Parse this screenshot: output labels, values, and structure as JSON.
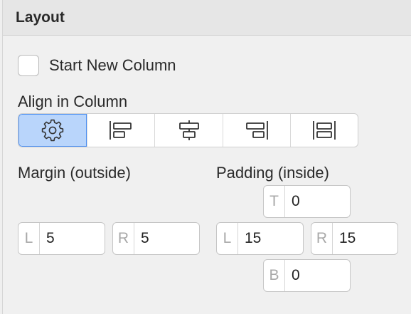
{
  "panel": {
    "title": "Layout"
  },
  "start_new_column": {
    "label": "Start New Column",
    "checked": false
  },
  "align": {
    "label": "Align in Column",
    "options": [
      {
        "icon": "gear-icon",
        "selected": true
      },
      {
        "icon": "align-left-icon",
        "selected": false
      },
      {
        "icon": "align-center-icon",
        "selected": false
      },
      {
        "icon": "align-right-icon",
        "selected": false
      },
      {
        "icon": "align-justify-icon",
        "selected": false
      }
    ]
  },
  "margin": {
    "label": "Margin (outside)",
    "left": {
      "prefix": "L",
      "value": "5"
    },
    "right": {
      "prefix": "R",
      "value": "5"
    }
  },
  "padding": {
    "label": "Padding (inside)",
    "top": {
      "prefix": "T",
      "value": "0"
    },
    "left": {
      "prefix": "L",
      "value": "15"
    },
    "right": {
      "prefix": "R",
      "value": "15"
    },
    "bottom": {
      "prefix": "B",
      "value": "0"
    }
  },
  "colors": {
    "selected_bg": "#b9d5fb",
    "selected_border": "#4b8ff3",
    "icon": "#333333"
  }
}
